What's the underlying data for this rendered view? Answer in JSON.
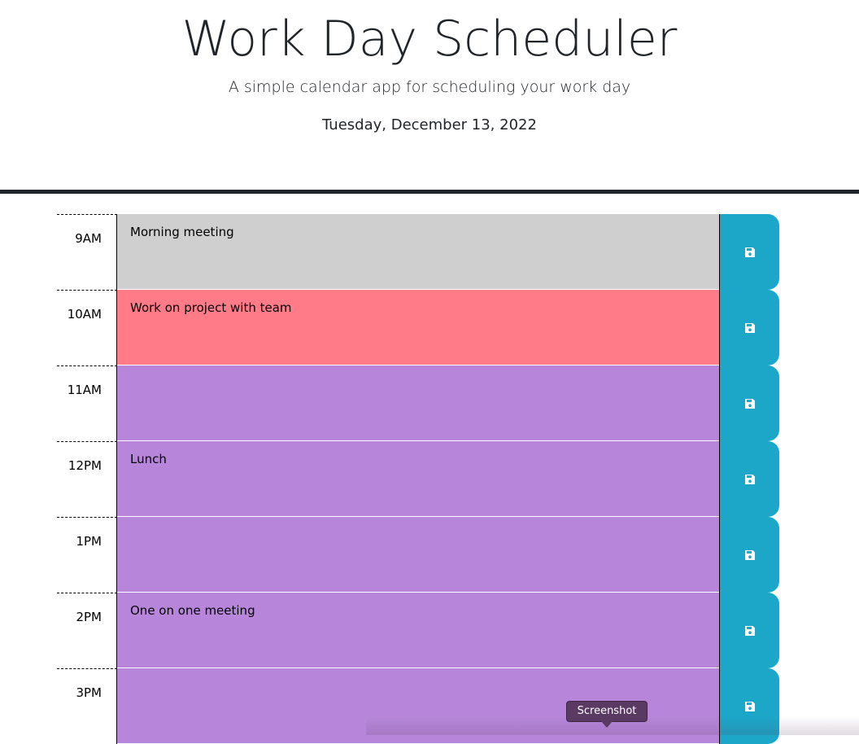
{
  "header": {
    "title": "Work Day Scheduler",
    "subtitle": "A simple calendar app for scheduling your work day",
    "current_day": "Tuesday, December 13, 2022"
  },
  "colors": {
    "past": "#cfcfcf",
    "present": "#ff7b87",
    "future": "#b786da",
    "save_button": "#1ca7c9",
    "divider": "#212529"
  },
  "time_blocks": [
    {
      "hour": "9AM",
      "text": "Morning meeting",
      "state": "past",
      "save_icon": "floppy-disk-icon"
    },
    {
      "hour": "10AM",
      "text": "Work on project with team",
      "state": "present",
      "save_icon": "floppy-disk-icon"
    },
    {
      "hour": "11AM",
      "text": "",
      "state": "future",
      "save_icon": "floppy-disk-icon"
    },
    {
      "hour": "12PM",
      "text": "Lunch",
      "state": "future",
      "save_icon": "floppy-disk-icon"
    },
    {
      "hour": "1PM",
      "text": "",
      "state": "future",
      "save_icon": "floppy-disk-icon"
    },
    {
      "hour": "2PM",
      "text": "One on one meeting",
      "state": "future",
      "save_icon": "floppy-disk-icon"
    },
    {
      "hour": "3PM",
      "text": "",
      "state": "future",
      "save_icon": "floppy-disk-icon"
    }
  ],
  "tooltip": {
    "label": "Screenshot"
  }
}
